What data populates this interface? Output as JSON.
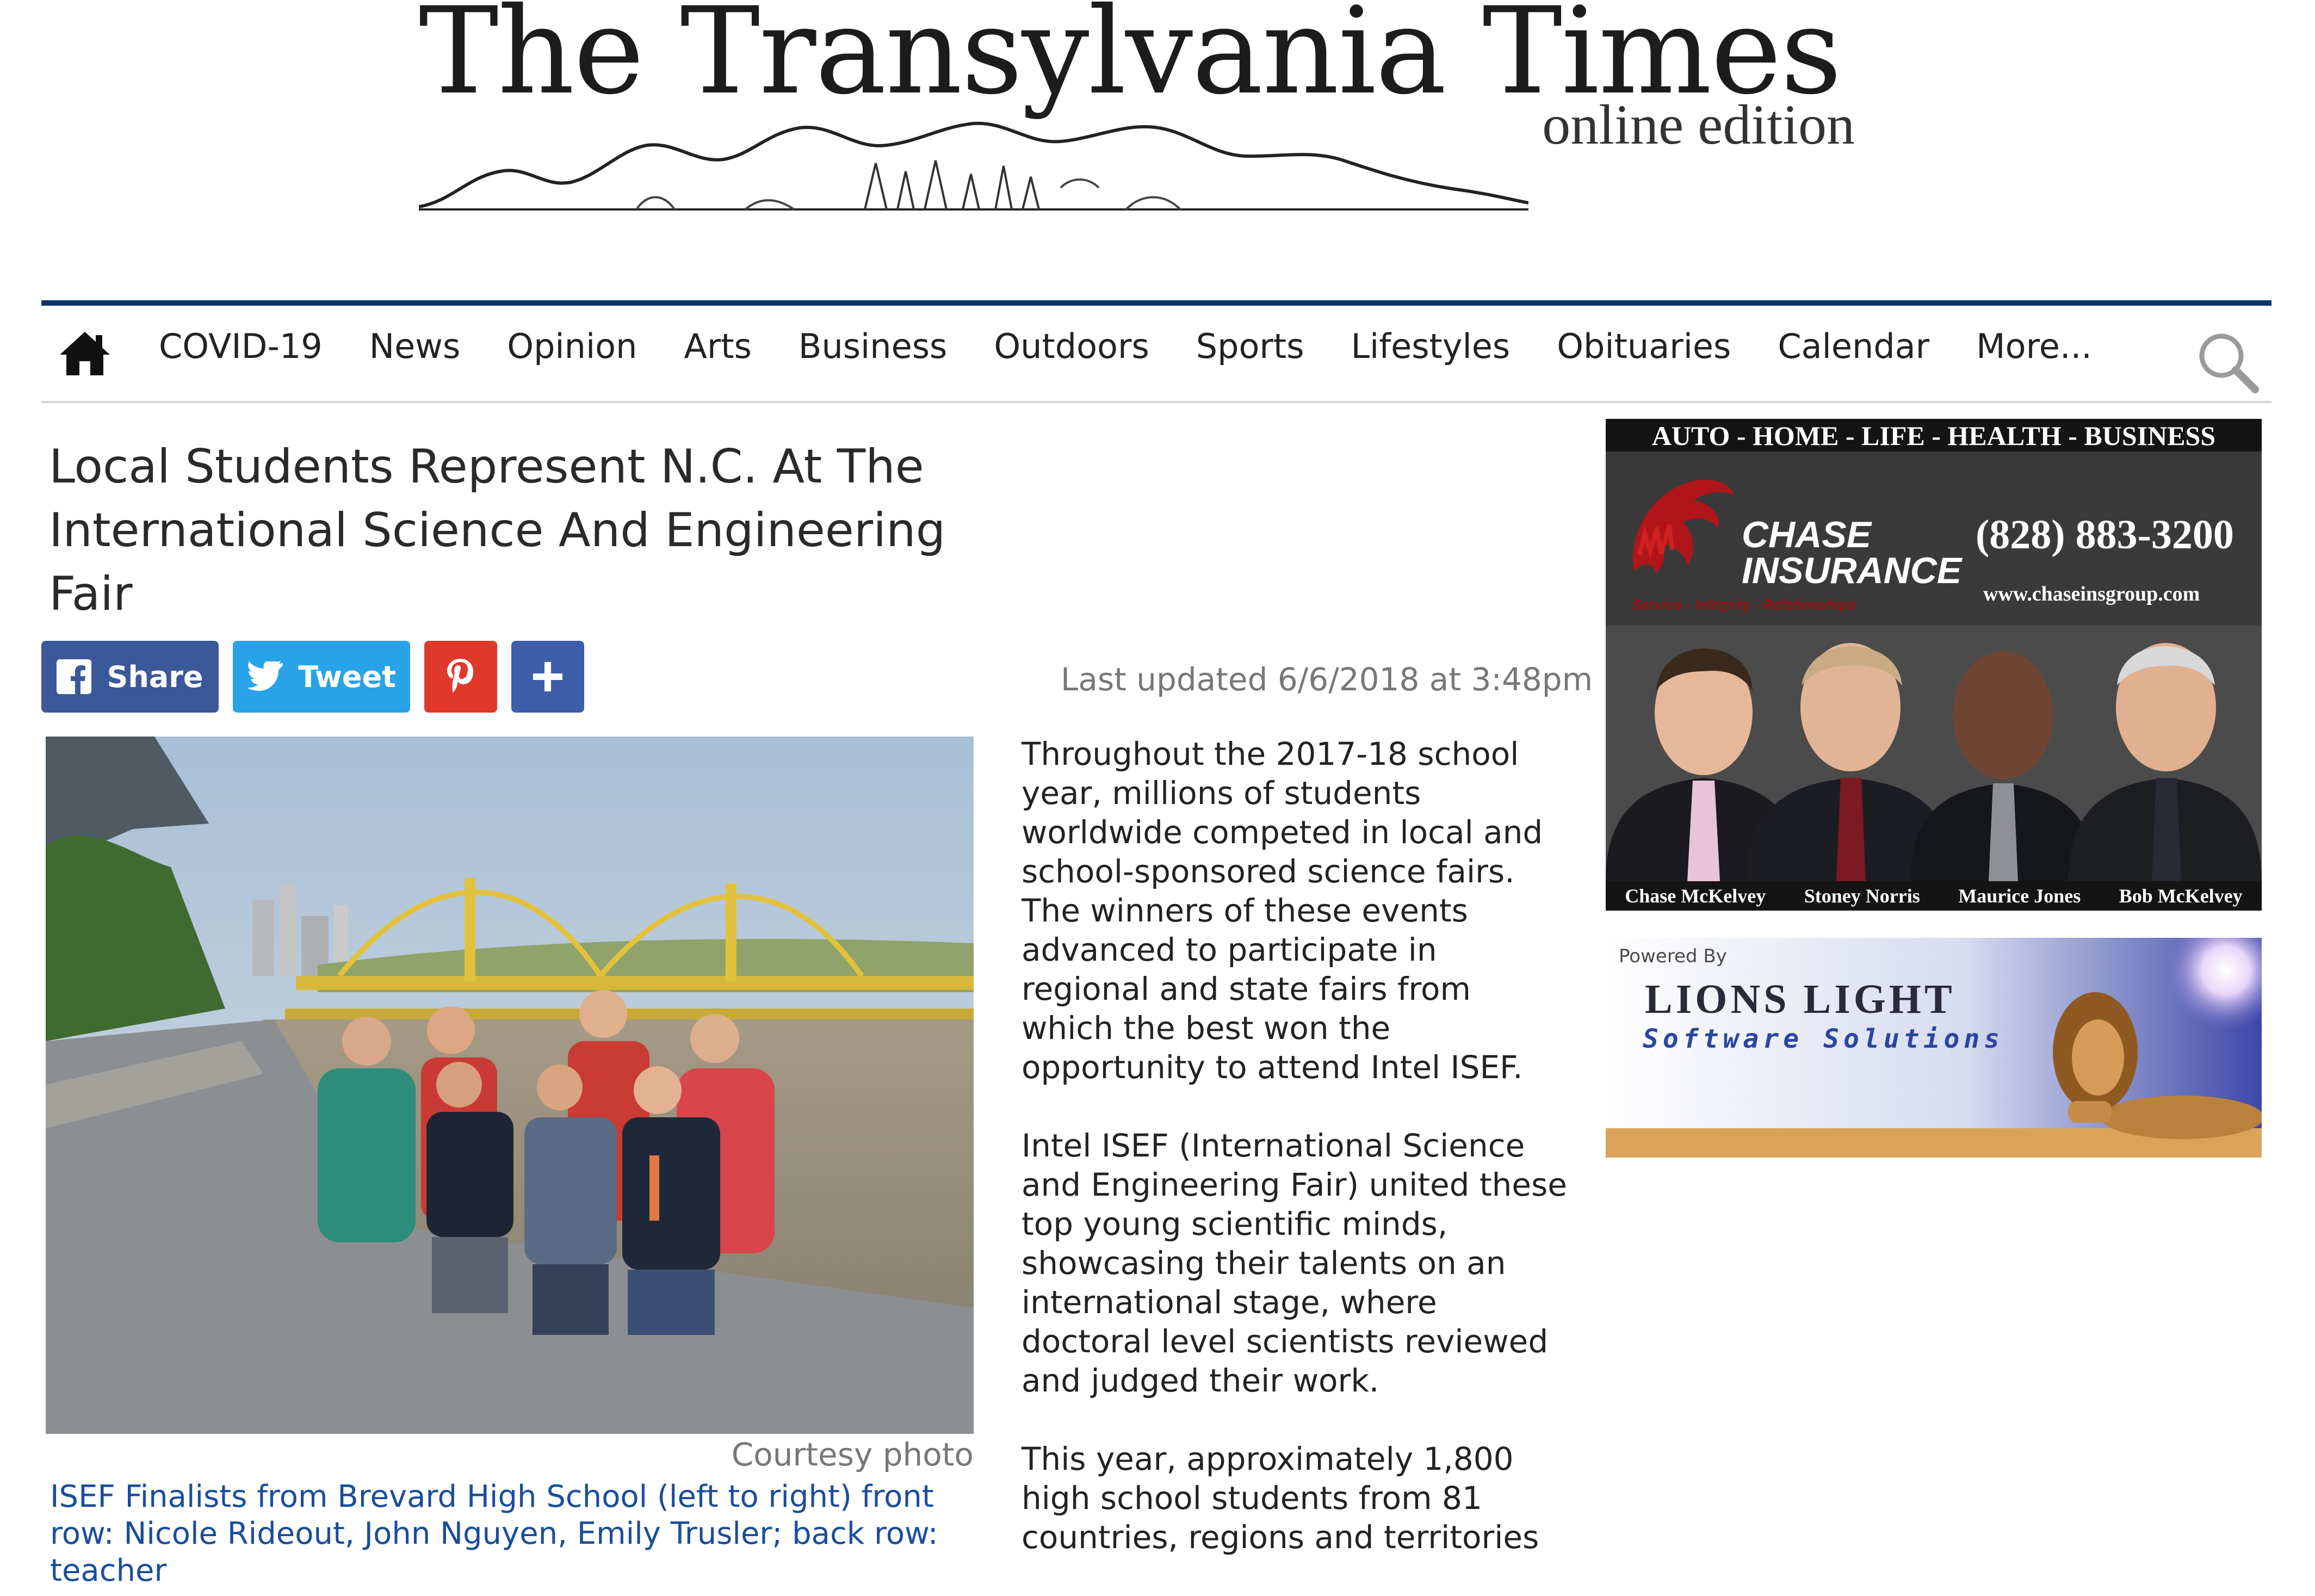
{
  "masthead": {
    "title": "The Transylvania Times",
    "subtitle": "online edition"
  },
  "nav": {
    "items": [
      "COVID-19",
      "News",
      "Opinion",
      "Arts",
      "Business",
      "Outdoors",
      "Sports",
      "Lifestyles",
      "Obituaries",
      "Calendar",
      "More..."
    ]
  },
  "article": {
    "headline": "Local Students Represent N.C. At The International Science And Engineering Fair",
    "share": {
      "share_label": "Share",
      "tweet_label": "Tweet"
    },
    "last_updated": "Last updated 6/6/2018 at 3:48pm",
    "photo_credit": "Courtesy photo",
    "caption": "ISEF Finalists from Brevard High School (left to right) front row: Nicole Rideout, John Nguyen, Emily Trusler; back row: teacher",
    "paragraphs": [
      "Throughout the 2017-18 school year, millions of students worldwide competed in local and school-sponsored science fairs. The winners of these events advanced to participate in regional and state fairs from which the best won the opportunity to attend Intel ISEF.",
      "Intel ISEF (International Science and Engineering Fair) united these top young scientific minds, showcasing their talents on an international stage, where doctoral level scientists reviewed and judged their work.",
      "This year, approximately 1,800 high school students from 81 countries, regions and territories"
    ]
  },
  "ads": {
    "chase": {
      "strip": "AUTO - HOME - LIFE - HEALTH - BUSINESS",
      "company_line1": "CHASE",
      "company_line2": "INSURANCE",
      "tagline": "Service - Integrity - Relationships",
      "phone": "(828) 883-3200",
      "website": "www.chaseinsgroup.com",
      "names": [
        "Chase McKelvey",
        "Stoney Norris",
        "Maurice Jones",
        "Bob McKelvey"
      ]
    },
    "lions": {
      "powered_by": "Powered By",
      "title": "LIONS LIGHT",
      "subtitle": "Software Solutions"
    }
  },
  "colors": {
    "nav_rule": "#0d3566",
    "facebook": "#3b5998",
    "twitter": "#28a3e8",
    "pinterest": "#e0392b",
    "addthis": "#3d5ea8",
    "caption_link": "#1a4d9c"
  }
}
